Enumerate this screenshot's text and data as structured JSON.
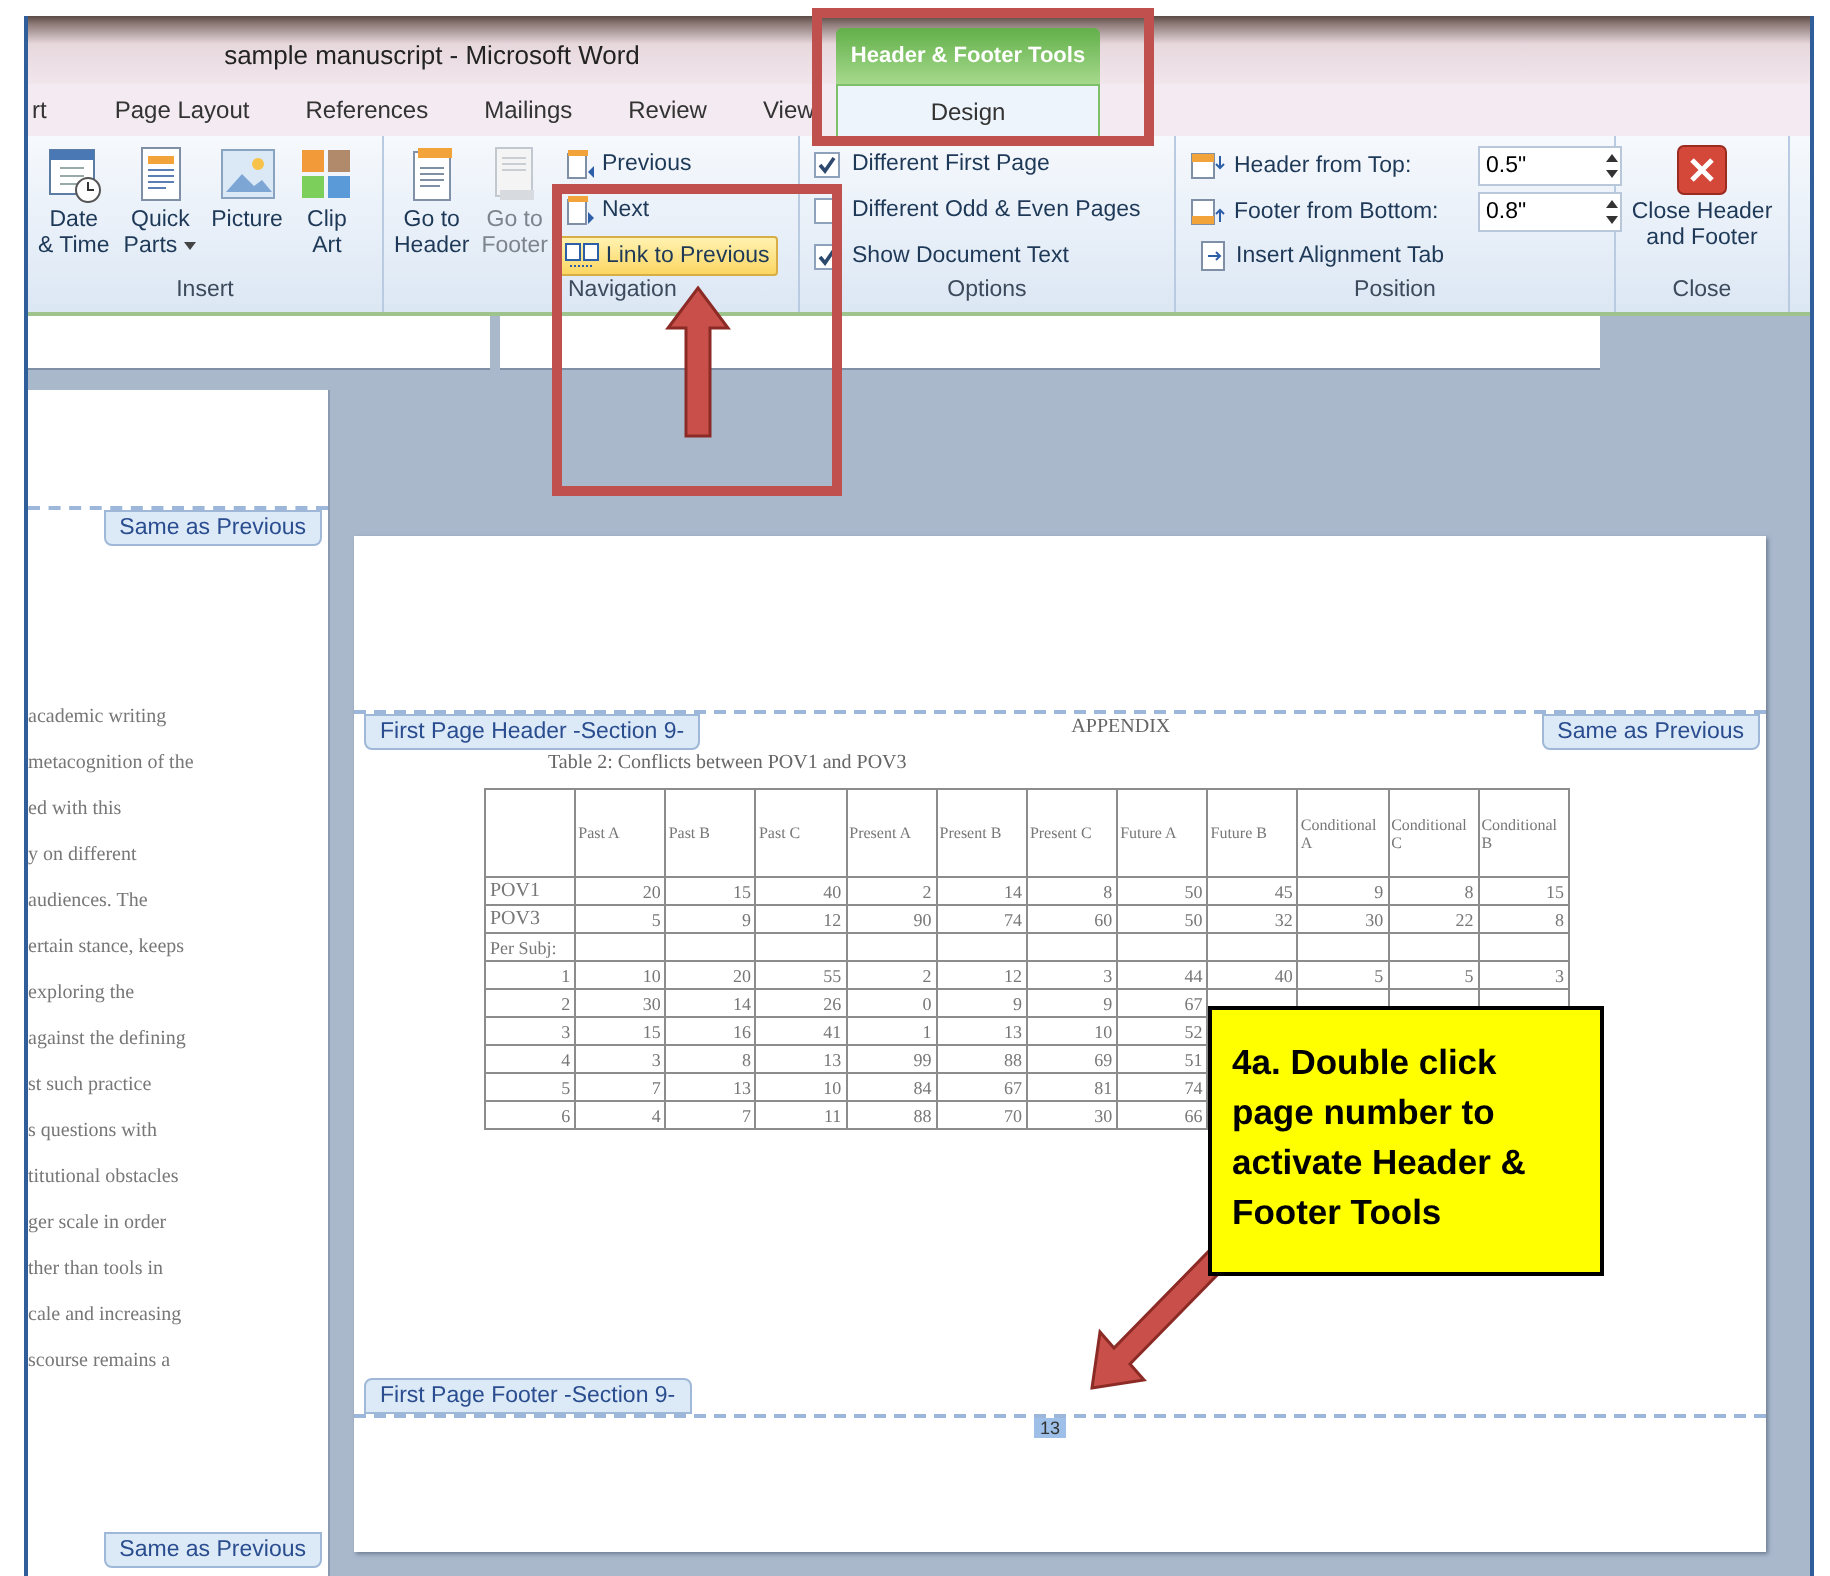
{
  "window": {
    "title": "sample manuscript  -  Microsoft Word",
    "contextual_group": "Header & Footer Tools"
  },
  "tabs": [
    {
      "label": "rt",
      "selected": false
    },
    {
      "label": "Page Layout",
      "selected": false
    },
    {
      "label": "References",
      "selected": false
    },
    {
      "label": "Mailings",
      "selected": false
    },
    {
      "label": "Review",
      "selected": false
    },
    {
      "label": "View",
      "selected": false
    },
    {
      "label": "Design",
      "selected": true
    }
  ],
  "ribbon": {
    "insert": {
      "label": "Insert",
      "buttons": [
        {
          "lines": [
            "Date",
            "& Time"
          ]
        },
        {
          "lines": [
            "Quick",
            "Parts"
          ],
          "dropdown": true
        },
        {
          "lines": [
            "Picture"
          ]
        },
        {
          "lines": [
            "Clip",
            "Art"
          ]
        }
      ]
    },
    "navigation": {
      "label": "Navigation",
      "large": [
        {
          "lines": [
            "Go to",
            "Header"
          ],
          "disabled": false
        },
        {
          "lines": [
            "Go to",
            "Footer"
          ],
          "disabled": true
        }
      ],
      "small": [
        {
          "label": "Previous",
          "on": false
        },
        {
          "label": "Next",
          "on": false
        },
        {
          "label": "Link to Previous",
          "on": true
        }
      ]
    },
    "options": {
      "label": "Options",
      "items": [
        {
          "label": "Different First Page",
          "checked": true
        },
        {
          "label": "Different Odd & Even Pages",
          "checked": false
        },
        {
          "label": "Show Document Text",
          "checked": true
        }
      ]
    },
    "position": {
      "label": "Position",
      "fields": [
        {
          "label": "Header from Top:",
          "value": "0.5\""
        },
        {
          "label": "Footer from Bottom:",
          "value": "0.8\""
        }
      ],
      "button": "Insert Alignment Tab"
    },
    "close": {
      "label": "Close",
      "button": [
        "Close Header",
        "and Footer"
      ]
    }
  },
  "left_page": {
    "top_tag": "Same as Previous",
    "lines": [
      "academic writing",
      "metacognition of the",
      "ed with this",
      "y on different",
      "audiences.  The",
      "ertain stance, keeps",
      "exploring the",
      "against the defining",
      "st such practice",
      "s questions with",
      "titutional obstacles",
      "ger scale in order",
      "ther than tools in",
      "cale and increasing",
      "scourse remains a"
    ],
    "bottom_tag": "Same as Previous"
  },
  "page": {
    "header_tag": "First Page Header -Section 9-",
    "header_text": "APPENDIX",
    "header_link_tag": "Same as Previous",
    "caption": "Table 2:  Conflicts between POV1 and POV3",
    "table": {
      "columns": [
        "",
        "Past A",
        "Past B",
        "Past C",
        "Present A",
        "Present B",
        "Present C",
        "Future A",
        "Future B",
        "Conditional A",
        "Conditional C",
        "Conditional B"
      ],
      "rows": [
        {
          "kind": "named",
          "cells": [
            "POV1",
            "20",
            "15",
            "40",
            "2",
            "14",
            "8",
            "50",
            "45",
            "9",
            "8",
            "15"
          ]
        },
        {
          "kind": "named",
          "cells": [
            "POV3",
            "5",
            "9",
            "12",
            "90",
            "74",
            "60",
            "50",
            "32",
            "30",
            "22",
            "8"
          ]
        },
        {
          "kind": "named",
          "cells": [
            "Per Subj:"
          ]
        },
        {
          "kind": "numbered",
          "cells": [
            "1",
            "10",
            "20",
            "55",
            "2",
            "12",
            "3",
            "44",
            "40",
            "5",
            "5",
            "3"
          ]
        },
        {
          "kind": "numbered",
          "cells": [
            "2",
            "30",
            "14",
            "26",
            "0",
            "9",
            "9",
            "67"
          ]
        },
        {
          "kind": "numbered",
          "cells": [
            "3",
            "15",
            "16",
            "41",
            "1",
            "13",
            "10",
            "52"
          ]
        },
        {
          "kind": "numbered",
          "cells": [
            "4",
            "3",
            "8",
            "13",
            "99",
            "88",
            "69",
            "51"
          ]
        },
        {
          "kind": "numbered",
          "cells": [
            "5",
            "7",
            "13",
            "10",
            "84",
            "67",
            "81",
            "74"
          ]
        },
        {
          "kind": "numbered",
          "cells": [
            "6",
            "4",
            "7",
            "11",
            "88",
            "70",
            "30",
            "66"
          ]
        }
      ]
    },
    "footer_tag": "First Page Footer -Section 9-",
    "page_number": "13"
  },
  "callout": "4a. Double click page number to activate Header & Footer Tools"
}
